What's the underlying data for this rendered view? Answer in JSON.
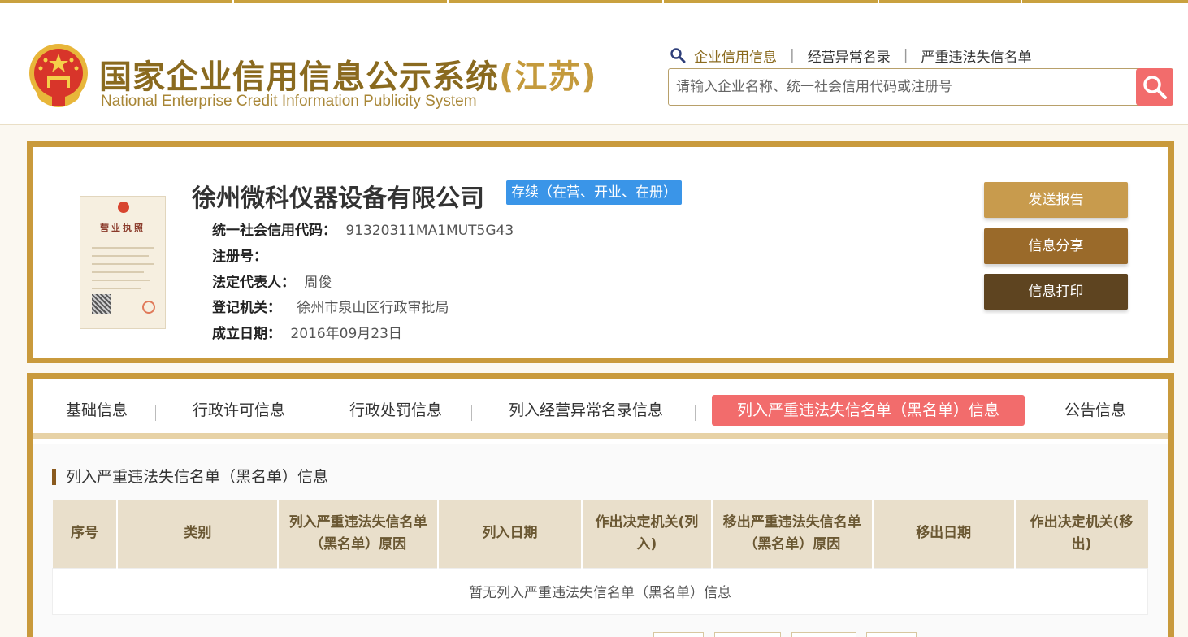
{
  "site": {
    "title_cn": "国家企业信用信息公示系统",
    "title_province": "(江苏)",
    "title_en": "National Enterprise Credit Information Publicity System"
  },
  "topnav": {
    "items": [
      "企业信用信息",
      "经营异常名录",
      "严重违法失信名单"
    ],
    "separator": "|"
  },
  "search": {
    "placeholder": "请输入企业名称、统一社会信用代码或注册号"
  },
  "company": {
    "license_heading": "营业执照",
    "name": "徐州微科仪器设备有限公司",
    "status": "存续（在营、开业、在册）",
    "fields": [
      {
        "label": "统一社会信用代码：",
        "value": "91320311MA1MUT5G43"
      },
      {
        "label": "注册号：",
        "value": ""
      },
      {
        "label": "法定代表人：",
        "value": "周俊"
      },
      {
        "label": "登记机关：",
        "value": "徐州市泉山区行政审批局"
      },
      {
        "label": "成立日期：",
        "value": "2016年09月23日"
      }
    ]
  },
  "actions": {
    "send_report": "发送报告",
    "share": "信息分享",
    "print": "信息打印"
  },
  "tabs": [
    "基础信息",
    "行政许可信息",
    "行政处罚信息",
    "列入经营异常名录信息",
    "列入严重违法失信名单（黑名单）信息",
    "公告信息"
  ],
  "active_tab": 4,
  "section": {
    "title": "列入严重违法失信名单（黑名单）信息",
    "columns": [
      "序号",
      "类别",
      "列入严重违法失信名单（黑名单）原因",
      "列入日期",
      "作出决定机关(列入)",
      "移出严重违法失信名单（黑名单）原因",
      "移出日期",
      "作出决定机关(移出)"
    ],
    "empty_text": "暂无列入严重违法失信名单（黑名单）信息"
  },
  "colors": {
    "accent_gold": "#c99a3c",
    "active_tab": "#f26c6c",
    "status_badge": "#3a95e8"
  }
}
